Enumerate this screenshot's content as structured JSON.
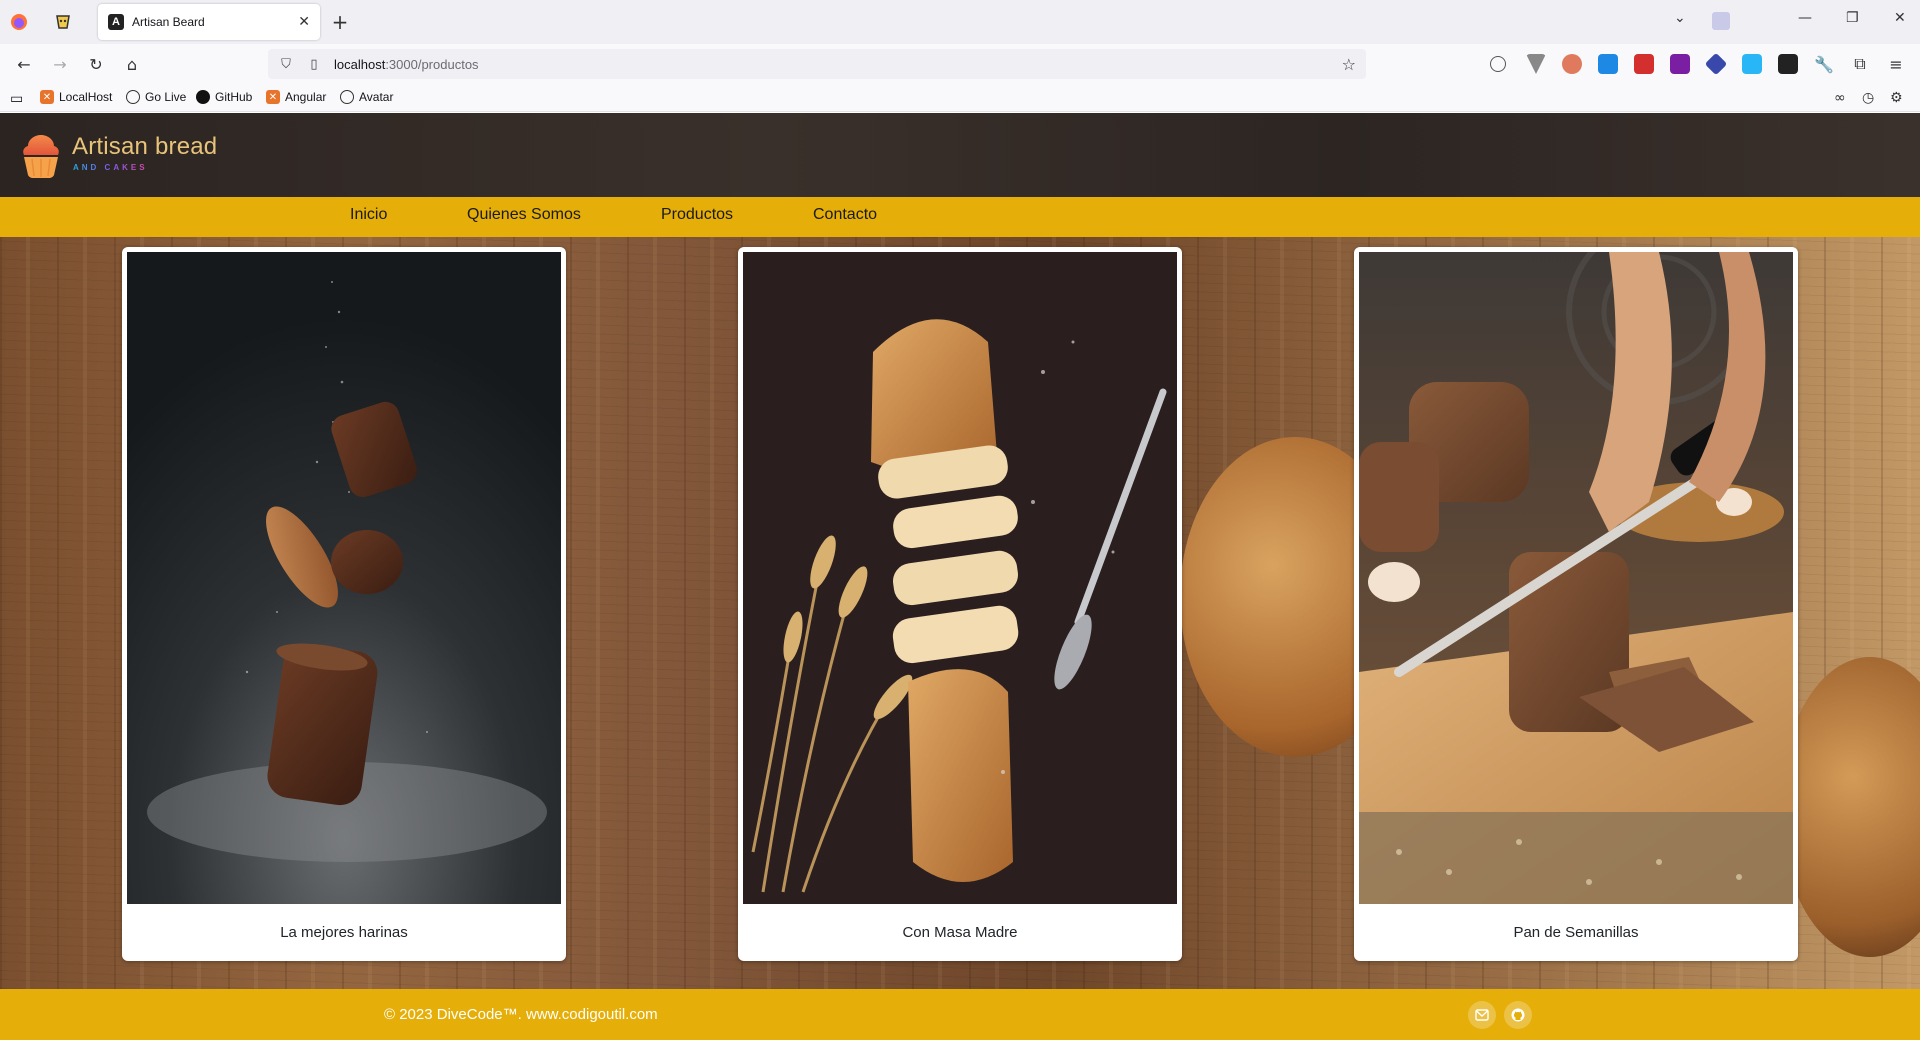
{
  "browser": {
    "tab_title": "Artisan Beard",
    "url_host": "localhost",
    "url_path": ":3000/productos",
    "bookmarks": [
      {
        "label": "LocalHost"
      },
      {
        "label": "Go Live"
      },
      {
        "label": "GitHub"
      },
      {
        "label": "Angular"
      },
      {
        "label": "Avatar"
      }
    ]
  },
  "site": {
    "logo_main": "Artisan bread",
    "logo_sub": "AND CAKES",
    "menu": [
      {
        "label": "Inicio"
      },
      {
        "label": "Quienes Somos"
      },
      {
        "label": "Productos"
      },
      {
        "label": "Contacto"
      }
    ],
    "products": [
      {
        "caption": "La mejores harinas"
      },
      {
        "caption": "Con Masa Madre"
      },
      {
        "caption": "Pan de Semanillas"
      }
    ],
    "footer_text": "© 2023 DiveCode™. www.codigoutil.com",
    "footer_icons": [
      "mail-icon",
      "github-icon"
    ]
  },
  "colors": {
    "header_bg": "#2b2421",
    "menu_bg": "#e5ae08",
    "footer_bg": "#e5ae08",
    "logo_text": "#e8c37a"
  }
}
